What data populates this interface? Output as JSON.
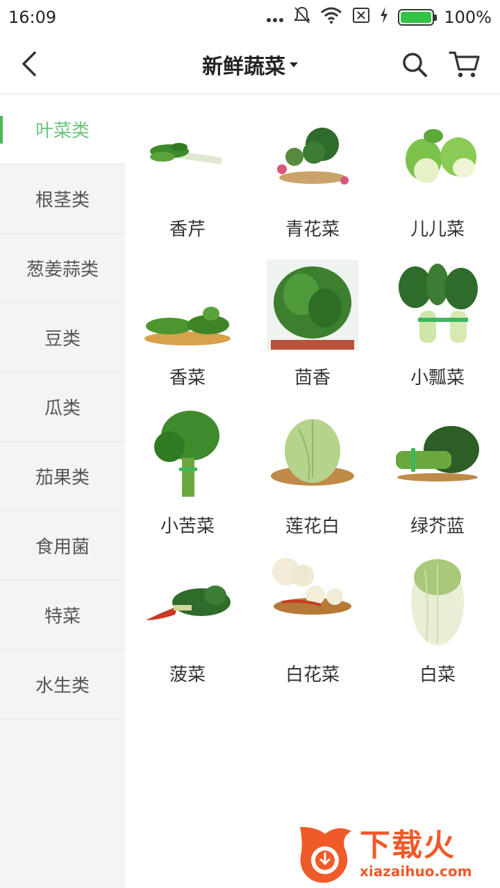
{
  "status": {
    "time": "16:09",
    "battery_pct": "100%",
    "battery_level": 1.0
  },
  "header": {
    "title": "新鲜蔬菜"
  },
  "sidebar": {
    "items": [
      {
        "label": "叶菜类",
        "active": true
      },
      {
        "label": "根茎类"
      },
      {
        "label": "葱姜蒜类"
      },
      {
        "label": "豆类"
      },
      {
        "label": "瓜类"
      },
      {
        "label": "茄果类"
      },
      {
        "label": "食用菌"
      },
      {
        "label": "特菜"
      },
      {
        "label": "水生类"
      }
    ]
  },
  "products": [
    {
      "name": "香芹"
    },
    {
      "name": "青花菜"
    },
    {
      "name": "儿儿菜"
    },
    {
      "name": "香菜"
    },
    {
      "name": "茴香"
    },
    {
      "name": "小瓢菜"
    },
    {
      "name": "小苦菜"
    },
    {
      "name": "莲花白"
    },
    {
      "name": "绿芥蓝"
    },
    {
      "name": "菠菜"
    },
    {
      "name": "白花菜"
    },
    {
      "name": "白菜"
    }
  ],
  "watermark": {
    "title": "下载火",
    "url": "xiazaihuo.com"
  },
  "colors": {
    "accent": "#6cc37a",
    "watermark": "#f05a28"
  }
}
